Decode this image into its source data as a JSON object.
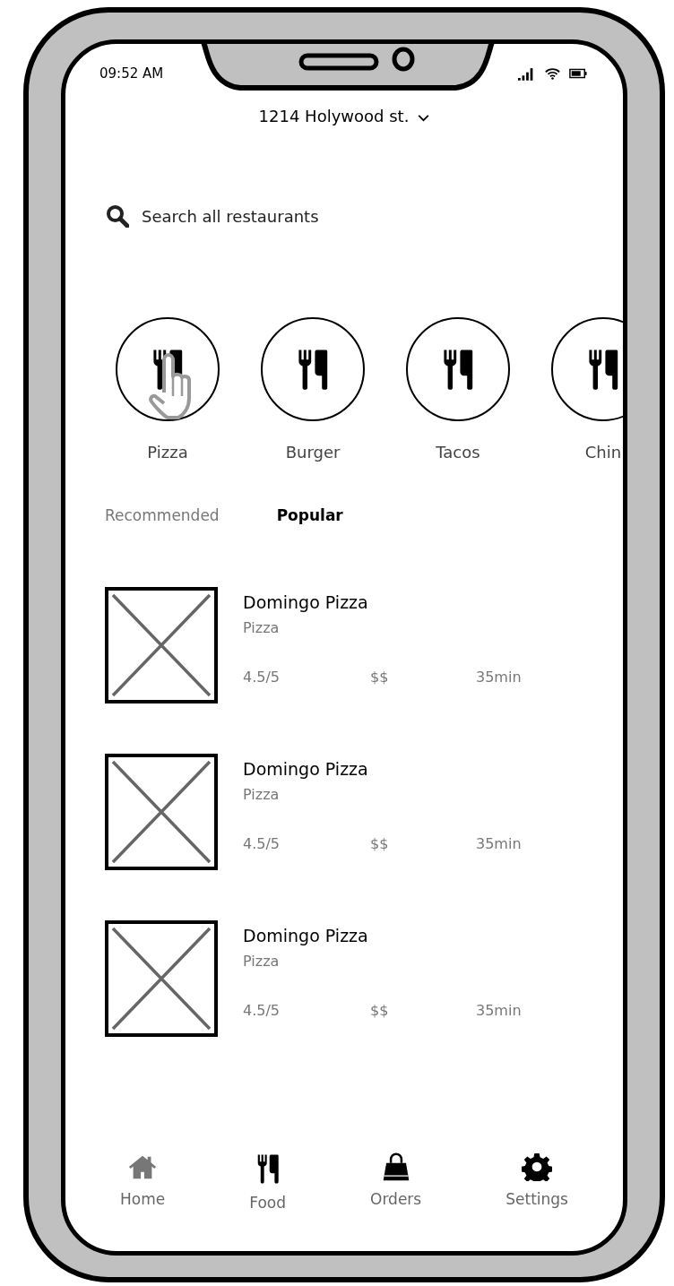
{
  "status_bar": {
    "time": "09:52 AM"
  },
  "address": {
    "text": "1214 Holywood st."
  },
  "search": {
    "placeholder": "Search all restaurants"
  },
  "categories": [
    {
      "label": "Pizza"
    },
    {
      "label": "Burger"
    },
    {
      "label": "Tacos"
    },
    {
      "label": "Chin"
    }
  ],
  "tabs": [
    {
      "label": "Recommended",
      "selected": false
    },
    {
      "label": "Popular",
      "selected": true
    }
  ],
  "restaurants": [
    {
      "name": "Domingo Pizza",
      "cuisine": "Pizza",
      "rating": "4.5/5",
      "price": "$$",
      "time": "35min"
    },
    {
      "name": "Domingo Pizza",
      "cuisine": "Pizza",
      "rating": "4.5/5",
      "price": "$$",
      "time": "35min"
    },
    {
      "name": "Domingo Pizza",
      "cuisine": "Pizza",
      "rating": "4.5/5",
      "price": "$$",
      "time": "35min"
    }
  ],
  "nav": [
    {
      "label": "Home",
      "kind": "home",
      "dimmed": true
    },
    {
      "label": "Food",
      "kind": "food",
      "dimmed": false
    },
    {
      "label": "Orders",
      "kind": "orders",
      "dimmed": false
    },
    {
      "label": "Settings",
      "kind": "settings",
      "dimmed": false
    }
  ]
}
